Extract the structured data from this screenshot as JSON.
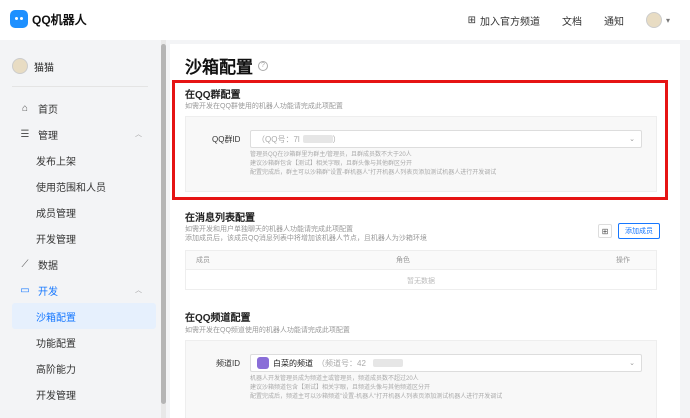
{
  "header": {
    "logo_text": "QQ机器人",
    "nav": [
      {
        "label": "加入官方频道",
        "icon": "grid-icon"
      },
      {
        "label": "文档"
      },
      {
        "label": "通知"
      }
    ]
  },
  "sidebar": {
    "user_name": "猫猫",
    "items": [
      {
        "label": "首页",
        "icon": "home-icon"
      },
      {
        "label": "管理",
        "icon": "list-icon",
        "chevron": "^"
      },
      {
        "label": "发布上架"
      },
      {
        "label": "使用范围和人员"
      },
      {
        "label": "成员管理"
      },
      {
        "label": "开发管理"
      },
      {
        "label": "数据",
        "icon": "chart-icon"
      },
      {
        "label": "开发",
        "icon": "monitor-icon",
        "chevron": "^"
      },
      {
        "label": "沙箱配置"
      },
      {
        "label": "功能配置"
      },
      {
        "label": "高阶能力"
      },
      {
        "label": "开发管理"
      }
    ]
  },
  "page": {
    "title": "沙箱配置",
    "help_icon": "?",
    "group_section": {
      "title": "在QQ群配置",
      "desc": "如需开发在QQ群使用的机器人功能请完成此项配置",
      "field_label": "QQ群ID",
      "field_value": "（QQ号：7l",
      "field_value_end": "）",
      "hints": [
        "管理员QQ在沙箱群里为群主/管理员，且群成员数不大于20人",
        "建议沙箱群包含【测试】相关字眼，且群头像与其他群区分开",
        "配置完成后，群主可以沙箱群\"设置-群机器人\"打开机器人列表页添加测试机器人进行开发调试"
      ]
    },
    "list_section": {
      "title": "在消息列表配置",
      "desc_1": "如需开发和用户单独聊天的机器人功能请完成此项配置",
      "desc_2": "添加成员后，该成员QQ消息列表中将增加该机器人节点，且机器人为沙箱环境",
      "add_button": "添加成员",
      "qr_icon": "⊞",
      "columns": [
        "成员",
        "角色",
        "操作"
      ],
      "empty_text": "暂无数据"
    },
    "channel_section": {
      "title": "在QQ频道配置",
      "desc": "如需开发在QQ频道使用的机器人功能请完成此项配置",
      "field_label": "频道ID",
      "channel_name": "白菜的频道",
      "channel_no": "（频道号：42",
      "hints": [
        "机器人开发管理员成为频道主或管理员，频道成员数不超过20人",
        "建议沙箱频道包含【测试】相关字眼，且频道头像与其他频道区分开",
        "配置完成后，频道主可以沙箱频道\"设置-机器人\"打开机器人列表页添加测试机器人进行开发调试"
      ]
    }
  }
}
